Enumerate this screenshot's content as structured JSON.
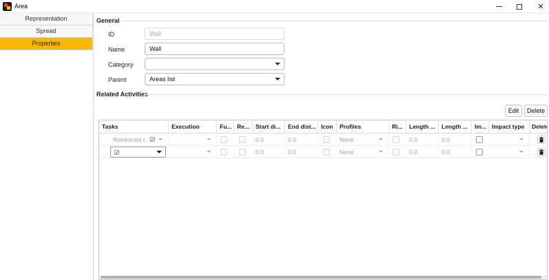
{
  "window": {
    "title": "Area"
  },
  "sidebar": {
    "items": [
      {
        "label": "Representation",
        "active": false
      },
      {
        "label": "Spread",
        "active": false
      },
      {
        "label": "Properties",
        "active": true
      }
    ]
  },
  "general": {
    "title": "General",
    "id_label": "ID",
    "id_value": "Wall",
    "name_label": "Name",
    "name_value": "Wall",
    "category_label": "Category",
    "category_value": "",
    "parent_label": "Parent",
    "parent_value": "Areas list"
  },
  "activities": {
    "title": "Related Activities",
    "edit_label": "Edit",
    "delete_label": "Delete",
    "columns": [
      "Tasks",
      "Execution",
      "Fu...",
      "Re...",
      "Start di...",
      "End dist...",
      "Icon",
      "Profiles",
      "Ri...",
      "Length ...",
      "Length ...",
      "Im...",
      "Impact type",
      "Delete"
    ],
    "rows": [
      {
        "task": "Reinforced c...",
        "start": "0.0",
        "end": "0.0",
        "profile": "None",
        "length1": "0.0",
        "length2": "0.0"
      },
      {
        "task": "",
        "start": "0.0",
        "end": "0.0",
        "profile": "None",
        "length1": "0.0",
        "length2": "0.0"
      }
    ]
  },
  "colors": {
    "accent": "#f8b800"
  }
}
